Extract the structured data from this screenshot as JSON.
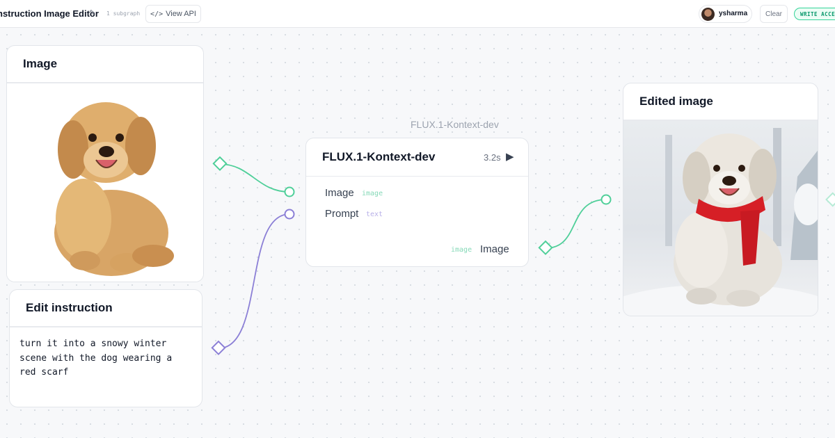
{
  "header": {
    "app_title": "nstruction Image Editor",
    "subgraph_count": "1 subgraph",
    "view_api_label": "View API",
    "username": "ysharma",
    "clear_label": "Clear",
    "access_badge": "WRITE ACCESS"
  },
  "nodes": {
    "image_input": {
      "title": "Image"
    },
    "edit_instruction": {
      "title": "Edit instruction",
      "value": "turn it into a snowy winter\nscene with the dog wearing a\nred scarf"
    },
    "flux": {
      "caption": "FLUX.1-Kontext-dev",
      "title": "FLUX.1-Kontext-dev",
      "duration": "3.2s",
      "inputs": [
        {
          "label": "Image",
          "type": "image"
        },
        {
          "label": "Prompt",
          "type": "text"
        }
      ],
      "output": {
        "label": "Image",
        "type": "image"
      }
    },
    "output_image": {
      "title": "Edited image"
    }
  },
  "colors": {
    "image_port": "#4fcf99",
    "text_port": "#8b7fd6",
    "badge_green": "#059669"
  },
  "icons": {
    "edit": "pencil-icon",
    "api": "code-icon",
    "run": "play-icon"
  }
}
